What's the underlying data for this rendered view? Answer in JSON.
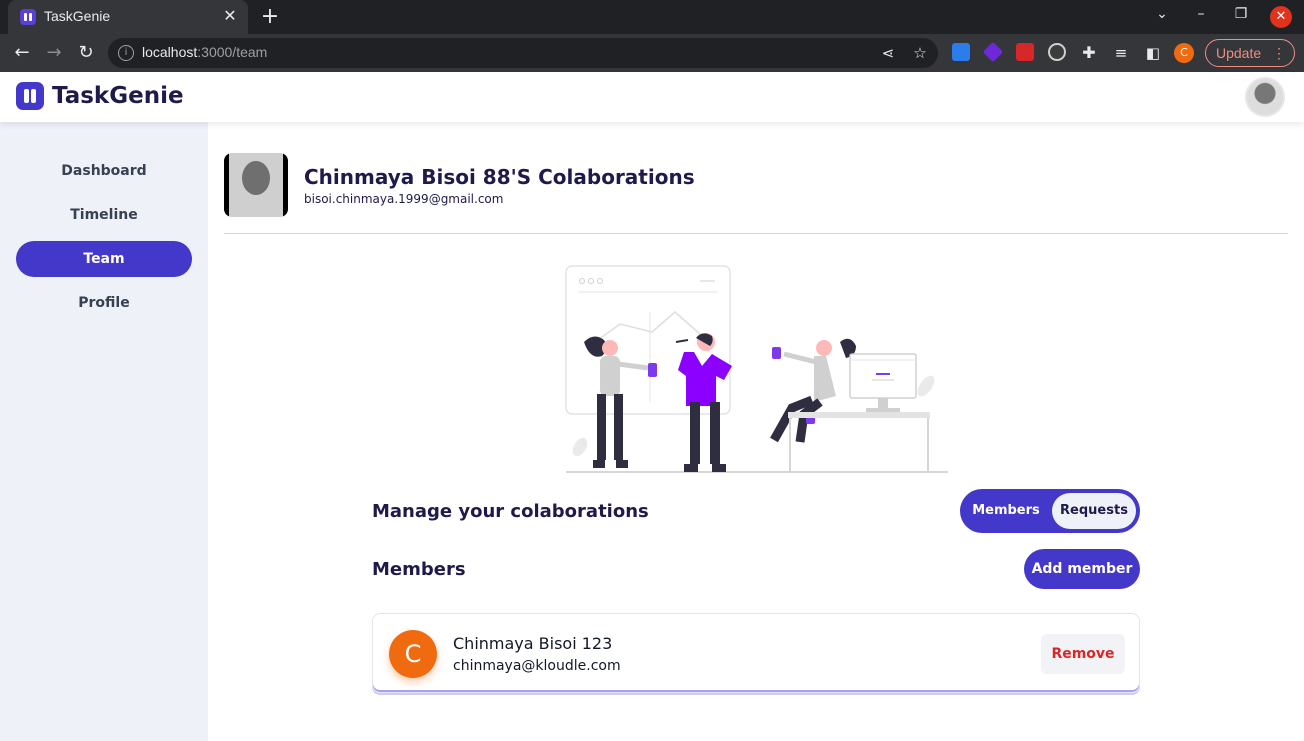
{
  "browser": {
    "tab_title": "TaskGenie",
    "tab_close": "✕",
    "new_tab": "+",
    "url_host": "localhost",
    "url_path": ":3000/team",
    "profile_initial": "C",
    "update_label": "Update"
  },
  "app": {
    "name": "TaskGenie"
  },
  "sidebar": {
    "items": [
      {
        "label": "Dashboard",
        "active": false
      },
      {
        "label": "Timeline",
        "active": false
      },
      {
        "label": "Team",
        "active": true
      },
      {
        "label": "Profile",
        "active": false
      }
    ]
  },
  "header": {
    "title": "Chinmaya Bisoi 88'S Colaborations",
    "email": "bisoi.chinmaya.1999@gmail.com"
  },
  "manage": {
    "title": "Manage your colaborations",
    "segments": [
      "Members",
      "Requests"
    ],
    "selected": "Requests"
  },
  "members_section": {
    "title": "Members",
    "add_label": "Add member",
    "list": [
      {
        "initial": "C",
        "name": "Chinmaya Bisoi 123",
        "email": "chinmaya@kloudle.com",
        "action": "Remove"
      }
    ]
  },
  "colors": {
    "primary": "#4338ca",
    "avatar_orange": "#f06a0f",
    "danger": "#dc2626",
    "sidebar_bg": "#eef1f8"
  }
}
